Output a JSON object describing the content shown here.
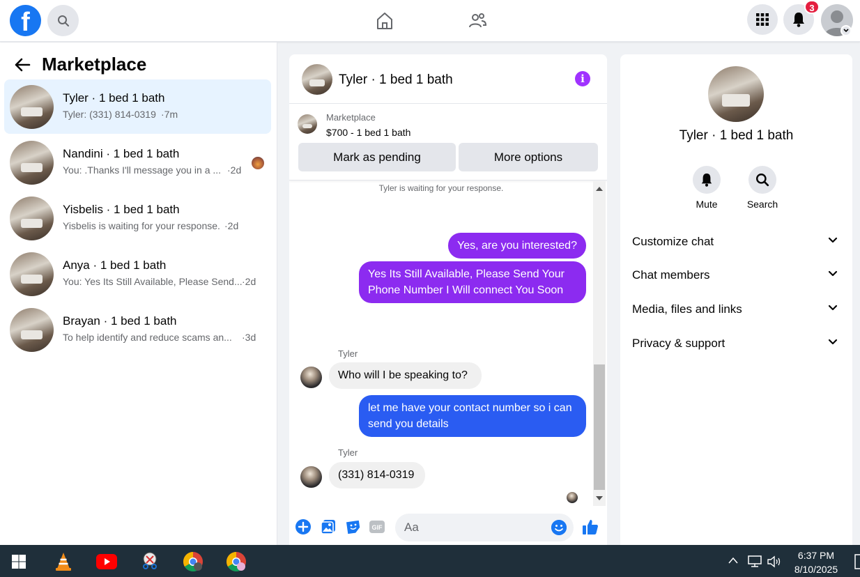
{
  "topbar": {
    "logo": "f",
    "notification_count": "3"
  },
  "sidebar": {
    "title": "Marketplace",
    "conversations": [
      {
        "name": "Tyler · 1 bed 1 bath",
        "preview": "Tyler: (331) 814-0319",
        "time": "·7m"
      },
      {
        "name": "Nandini · 1 bed 1 bath",
        "preview": "You: .Thanks I'll message you in a ...",
        "time": "·2d"
      },
      {
        "name": "Yisbelis · 1 bed 1 bath",
        "preview": "Yisbelis is waiting for your response.",
        "time": "·2d"
      },
      {
        "name": "Anya · 1 bed 1 bath",
        "preview": "You: Yes Its Still Available, Please Send...",
        "time": "·2d"
      },
      {
        "name": "Brayan · 1 bed 1 bath",
        "preview": "To help identify and reduce scams an...",
        "time": "·3d"
      }
    ]
  },
  "chat": {
    "title": "Tyler · 1 bed 1 bath",
    "listing": {
      "label": "Marketplace",
      "price": "$700 - 1 bed 1 bath",
      "mark_pending": "Mark as pending",
      "more_options": "More options"
    },
    "waiting_notice": "Tyler is waiting for your response.",
    "messages": [
      {
        "text": "Yes, are you interested?"
      },
      {
        "text": "Yes Its Still Available, Please Send Your Phone Number I Will connect You Soon"
      },
      {
        "sender": "Tyler",
        "text": "Who will I be speaking to?"
      },
      {
        "text": "let me have your contact number so i can send you details"
      },
      {
        "sender": "Tyler",
        "text": "(331) 814-0319"
      }
    ],
    "composer_placeholder": "Aa",
    "gif_label": "GIF"
  },
  "details": {
    "title": "Tyler · 1 bed 1 bath",
    "actions": [
      {
        "label": "Mute"
      },
      {
        "label": "Search"
      }
    ],
    "sections": [
      {
        "label": "Customize chat"
      },
      {
        "label": "Chat members"
      },
      {
        "label": "Media, files and links"
      },
      {
        "label": "Privacy & support"
      }
    ]
  },
  "taskbar": {
    "time": "6:37 PM",
    "date": "8/10/2025"
  },
  "colors": {
    "brand": "#1877f2",
    "outgoing_purple": "#8c2bf0",
    "outgoing_blue": "#2a5cf2",
    "notification": "#e41e3f"
  }
}
